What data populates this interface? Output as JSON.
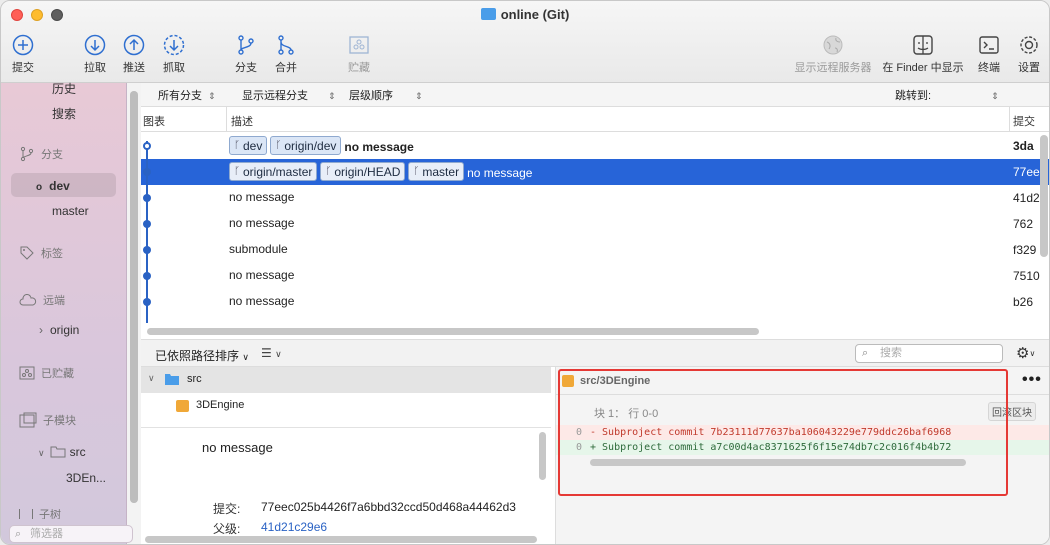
{
  "window": {
    "title": "online (Git)"
  },
  "toolbar": {
    "commit": "提交",
    "pull": "拉取",
    "push": "推送",
    "fetch": "抓取",
    "branch": "分支",
    "merge": "合并",
    "stash": "贮藏",
    "show_remote": "显示远程服务器",
    "show_in_finder": "在 Finder 中显示",
    "terminal": "终端",
    "settings": "设置"
  },
  "sidebar": {
    "history": "历史",
    "search": "搜索",
    "branches_header": "分支",
    "branch_dev": "dev",
    "branch_master": "master",
    "tags_header": "标签",
    "remotes_header": "远端",
    "remote_origin": "origin",
    "stashes_header": "已贮藏",
    "submodules_header": "子模块",
    "submodule_src": "src",
    "submodule_3d": "3DEn...",
    "subtrees_header": "子树",
    "filter_placeholder": "筛选器"
  },
  "filterbar": {
    "branches": "所有分支",
    "remote": "显示远程分支",
    "order": "层级顺序",
    "jump_to": "跳转到:"
  },
  "columns": {
    "graph": "图表",
    "description": "描述",
    "commit": "提交"
  },
  "commits": [
    {
      "tags": [
        "dev",
        "origin/dev"
      ],
      "message": "no message",
      "hash": "3da",
      "bold": true
    },
    {
      "tags": [
        "origin/master",
        "origin/HEAD",
        "master"
      ],
      "message": "no message",
      "hash": "77ee",
      "selected": true
    },
    {
      "tags": [],
      "message": "no message",
      "hash": "41d2"
    },
    {
      "tags": [],
      "message": "no message",
      "hash": "762"
    },
    {
      "tags": [],
      "message": "submodule",
      "hash": "f329"
    },
    {
      "tags": [],
      "message": "no message",
      "hash": "7510"
    },
    {
      "tags": [],
      "message": "no message",
      "hash": "b26"
    }
  ],
  "lower": {
    "sort": "已依照路径排序",
    "search_placeholder": "搜索"
  },
  "filetree": {
    "folder": "src",
    "file": "3DEngine"
  },
  "detail": {
    "message": "no message",
    "commit_label": "提交:",
    "commit_value": "77eec025b4426f7a6bbd32ccd50d468a44462d3",
    "parent_label": "父级:",
    "parent_value": "41d21c29e6"
  },
  "diff": {
    "file": "src/3DEngine",
    "hunk_title": "块 1： 行 0-0",
    "revert": "回滚区块",
    "removed": "- Subproject commit 7b23111d77637ba106043229e779ddc26baf6968",
    "added": "+ Subproject commit a7c00d4ac8371625f6f15e74db7c2c016f4b4b72",
    "gutter_del": "0",
    "gutter_add": "0"
  },
  "colors": {
    "accent": "#2764d8",
    "sidebar_top": "#e8c9d6",
    "annotation": "#e53935"
  }
}
